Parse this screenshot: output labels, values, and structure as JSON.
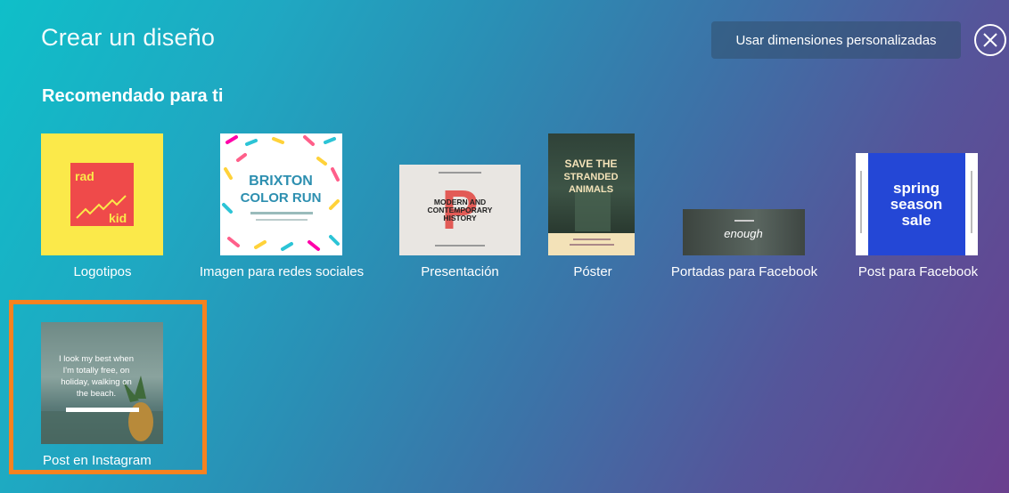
{
  "header": {
    "title": "Crear un diseño",
    "custom_dimensions_label": "Usar dimensiones personalizadas"
  },
  "section": {
    "title": "Recomendado para ti"
  },
  "cards": [
    {
      "label": "Logotipos",
      "thumb_text": [
        "rad",
        "kid"
      ]
    },
    {
      "label": "Imagen para redes sociales",
      "thumb_text": [
        "BRIXTON",
        "COLOR RUN"
      ]
    },
    {
      "label": "Presentación",
      "thumb_text": [
        "MODERN AND",
        "CONTEMPORARY",
        "HISTORY"
      ]
    },
    {
      "label": "Póster",
      "thumb_text": [
        "SAVE THE",
        "STRANDED",
        "ANIMALS"
      ]
    },
    {
      "label": "Portadas para Facebook",
      "thumb_text": [
        "enough"
      ]
    },
    {
      "label": "Post para Facebook",
      "thumb_text": [
        "spring",
        "season",
        "sale"
      ]
    },
    {
      "label": "Post en Instagram",
      "thumb_text": [
        "I look my best when",
        "I'm totally free, on",
        "holiday, walking on",
        "the beach."
      ]
    }
  ],
  "colors": {
    "selection": "#f6821f",
    "logo_bg": "#fbe94a",
    "logo_square": "#ef4a4a",
    "post_blue": "#2447d6"
  }
}
